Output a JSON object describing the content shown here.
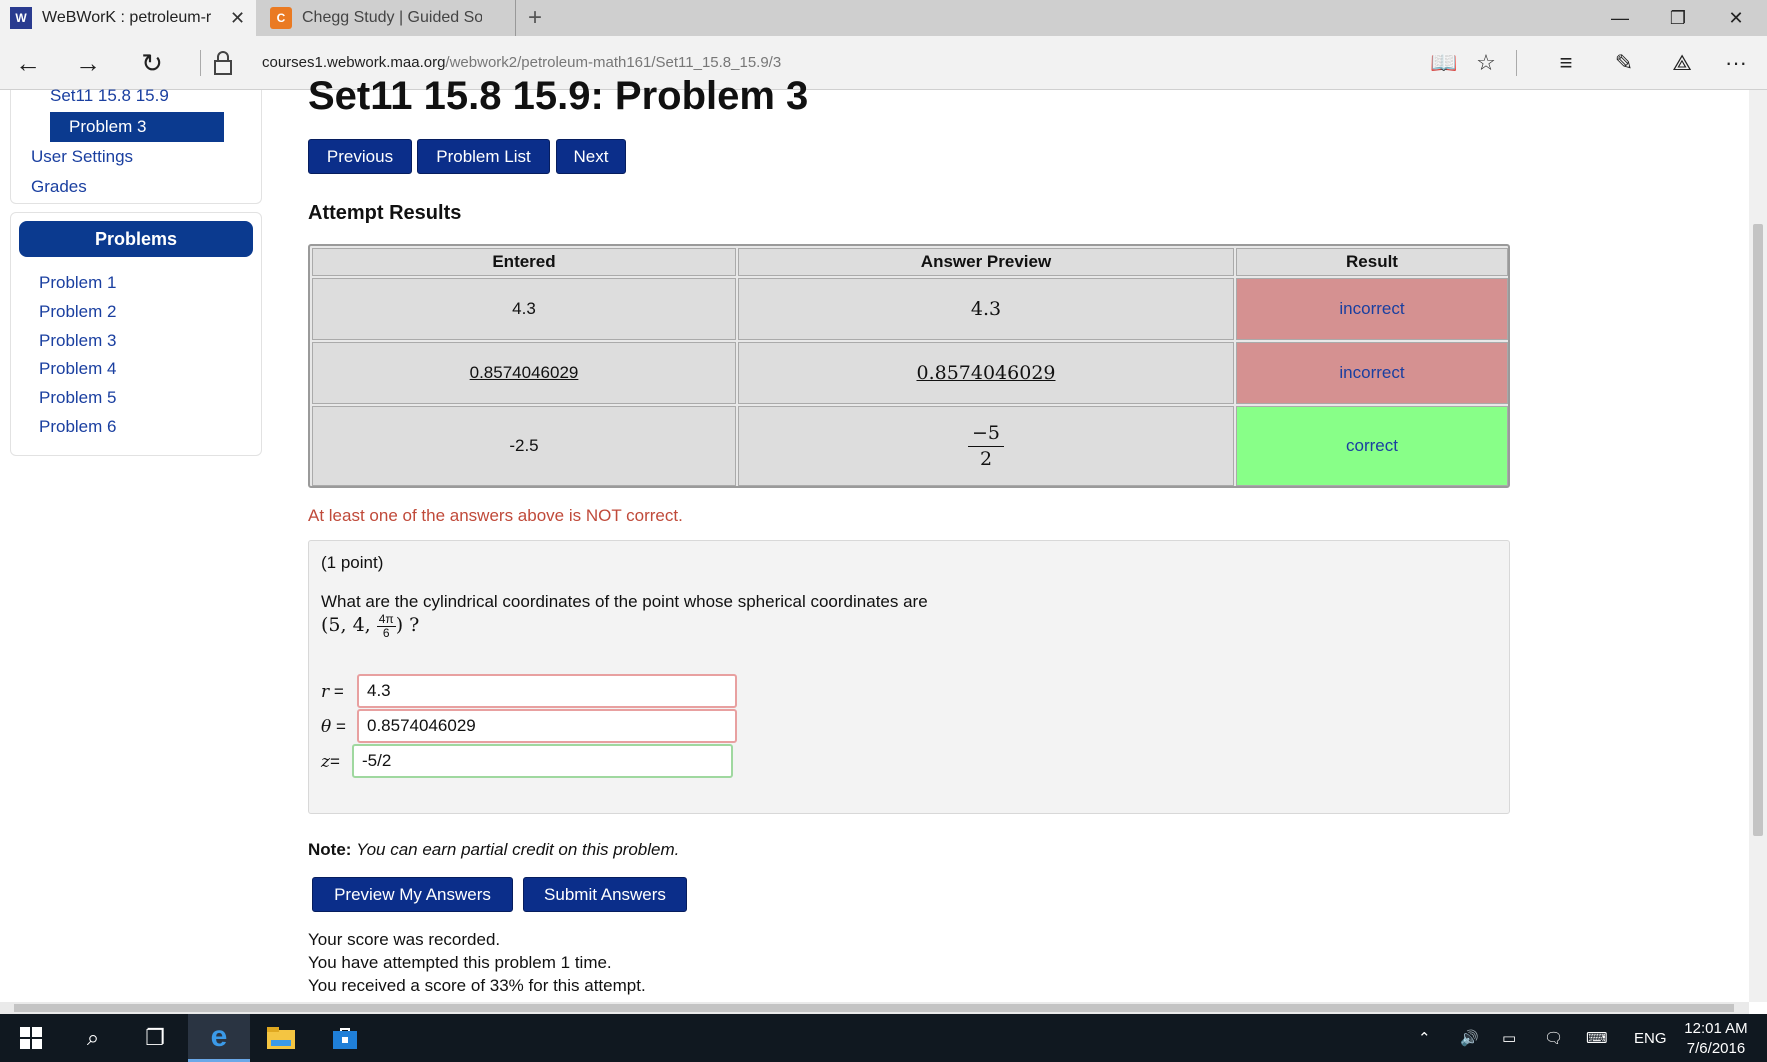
{
  "browser": {
    "tabs": [
      {
        "title": "WeBWorK : petroleum-r",
        "favicon": "webwork-icon"
      },
      {
        "title": "Chegg Study | Guided Solut",
        "favicon": "chegg-icon"
      }
    ],
    "url_host": "courses1.webwork.maa.org",
    "url_path": "/webwork2/petroleum-math161/Set11_15.8_15.9/3"
  },
  "sidebar": {
    "set_link": "Set11 15.8 15.9",
    "current_problem": "Problem 3",
    "user_settings": "User Settings",
    "grades": "Grades",
    "problems_header": "Problems",
    "problems": [
      "Problem 1",
      "Problem 2",
      "Problem 3",
      "Problem 4",
      "Problem 5",
      "Problem 6"
    ]
  },
  "main": {
    "title": "Set11 15.8 15.9: Problem 3",
    "nav": {
      "previous": "Previous",
      "problem_list": "Problem List",
      "next": "Next"
    },
    "attempt_heading": "Attempt Results",
    "results_table": {
      "headers": [
        "Entered",
        "Answer Preview",
        "Result"
      ],
      "rows": [
        {
          "entered": "4.3",
          "preview": "4.3",
          "result": "incorrect"
        },
        {
          "entered": "0.8574046029",
          "preview": "0.8574046029",
          "result": "incorrect"
        },
        {
          "entered": "-2.5",
          "preview_num": "−5",
          "preview_den": "2",
          "result": "correct"
        }
      ]
    },
    "not_correct_msg": "At least one of the answers above is NOT correct.",
    "problem": {
      "points": "(1 point)",
      "question": "What are the cylindrical coordinates of the point whose spherical coordinates are",
      "coord_prefix": "(5,  4,  ",
      "coord_frac_num": "4π",
      "coord_frac_den": "6",
      "coord_suffix": ") ?",
      "fields": [
        {
          "label": "r",
          "value": "4.3",
          "status": "incorrect"
        },
        {
          "label": "θ",
          "value": "0.8574046029",
          "status": "incorrect"
        },
        {
          "label": "z",
          "value": "-5/2",
          "status": "correct"
        }
      ]
    },
    "note_label": "Note:",
    "note_text": "You can earn partial credit on this problem.",
    "buttons": {
      "preview": "Preview My Answers",
      "submit": "Submit Answers"
    },
    "score_lines": [
      "Your score was recorded.",
      "You have attempted this problem 1 time.",
      "You received a score of 33% for this attempt."
    ]
  },
  "taskbar": {
    "lang": "ENG",
    "time": "12:01 AM",
    "date": "7/6/2016"
  }
}
